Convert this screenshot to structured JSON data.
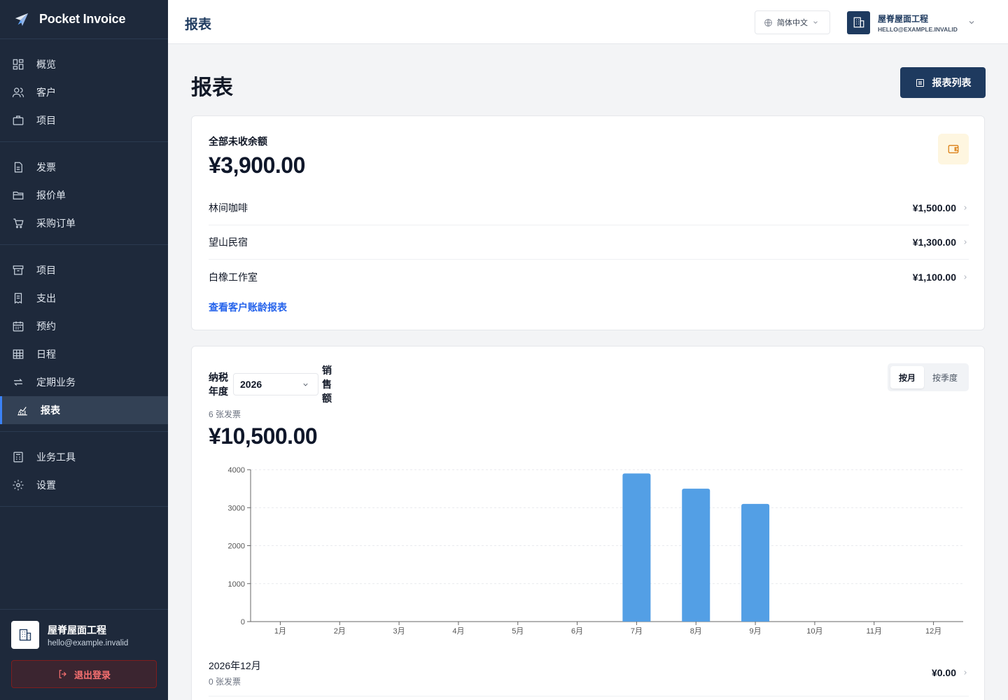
{
  "app": {
    "name": "Pocket Invoice"
  },
  "sidebar": {
    "groups": [
      [
        {
          "label": "概览",
          "icon": "dashboard-icon"
        },
        {
          "label": "客户",
          "icon": "users-icon"
        },
        {
          "label": "项目",
          "icon": "briefcase-icon"
        }
      ],
      [
        {
          "label": "发票",
          "icon": "file-icon"
        },
        {
          "label": "报价单",
          "icon": "folder-icon"
        },
        {
          "label": "采购订单",
          "icon": "cart-icon"
        }
      ],
      [
        {
          "label": "项目",
          "icon": "archive-icon"
        },
        {
          "label": "支出",
          "icon": "receipt-icon"
        },
        {
          "label": "预约",
          "icon": "calendar-icon"
        },
        {
          "label": "日程",
          "icon": "grid-icon"
        },
        {
          "label": "定期业务",
          "icon": "repeat-icon"
        },
        {
          "label": "报表",
          "icon": "chart-icon",
          "active": true
        }
      ],
      [
        {
          "label": "业务工具",
          "icon": "calculator-icon"
        },
        {
          "label": "设置",
          "icon": "gear-icon"
        }
      ]
    ],
    "org_name": "屋脊屋面工程",
    "org_email": "hello@example.invalid",
    "logout_label": "退出登录"
  },
  "topbar": {
    "title": "报表",
    "language": "简体中文",
    "account_name": "屋脊屋面工程",
    "account_email": "HELLO@EXAMPLE.INVALID"
  },
  "page": {
    "title": "报表",
    "list_button": "报表列表"
  },
  "receivables": {
    "label": "全部未收余额",
    "total": "¥3,900.00",
    "rows": [
      {
        "name": "林间咖啡",
        "amount": "¥1,500.00"
      },
      {
        "name": "望山民宿",
        "amount": "¥1,300.00"
      },
      {
        "name": "白橡工作室",
        "amount": "¥1,100.00"
      }
    ],
    "aging_link": "查看客户账龄报表"
  },
  "sales": {
    "fy_label": "纳税年度",
    "fy_value": "2026",
    "sales_label": "销售额",
    "invoice_count": "6 张发票",
    "total": "¥10,500.00",
    "tab_month": "按月",
    "tab_quarter": "按季度",
    "month_row": {
      "name": "2026年12月",
      "count": "0 张发票",
      "amount": "¥0.00"
    }
  },
  "colors": {
    "accent": "#1e3a5f",
    "bar": "#539fe5",
    "link": "#2563eb",
    "danger": "#f87171"
  },
  "chart_data": {
    "type": "bar",
    "categories": [
      "1月",
      "2月",
      "3月",
      "4月",
      "5月",
      "6月",
      "7月",
      "8月",
      "9月",
      "10月",
      "11月",
      "12月"
    ],
    "values": [
      0,
      0,
      0,
      0,
      0,
      0,
      3900,
      3500,
      3100,
      0,
      0,
      0
    ],
    "yticks": [
      0,
      1000,
      2000,
      3000,
      4000
    ],
    "ylim": [
      0,
      4000
    ],
    "grid": true
  }
}
